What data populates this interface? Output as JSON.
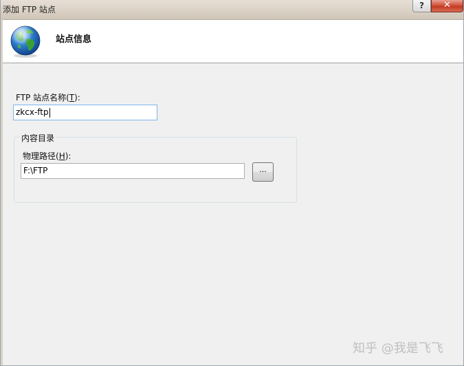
{
  "window": {
    "title": "添加 FTP 站点",
    "help_label": "?",
    "close_label": "✕"
  },
  "header": {
    "title": "站点信息",
    "icon": "globe-icon"
  },
  "site_name": {
    "label_prefix": "FTP 站点名称(",
    "label_accel": "T",
    "label_suffix": "):",
    "value": "zkcx-ftp"
  },
  "content_directory": {
    "group_title": "内容目录",
    "physical_path": {
      "label_prefix": "物理路径(",
      "label_accel": "H",
      "label_suffix": "):",
      "value": "F:\\FTP"
    },
    "browse_label": "..."
  },
  "watermark": "知乎 @我是飞飞",
  "colors": {
    "close_button": "#c94a32",
    "focus_border": "#7eb4ea",
    "header_background": "#ffffff",
    "dialog_background": "#f0f0f0"
  }
}
